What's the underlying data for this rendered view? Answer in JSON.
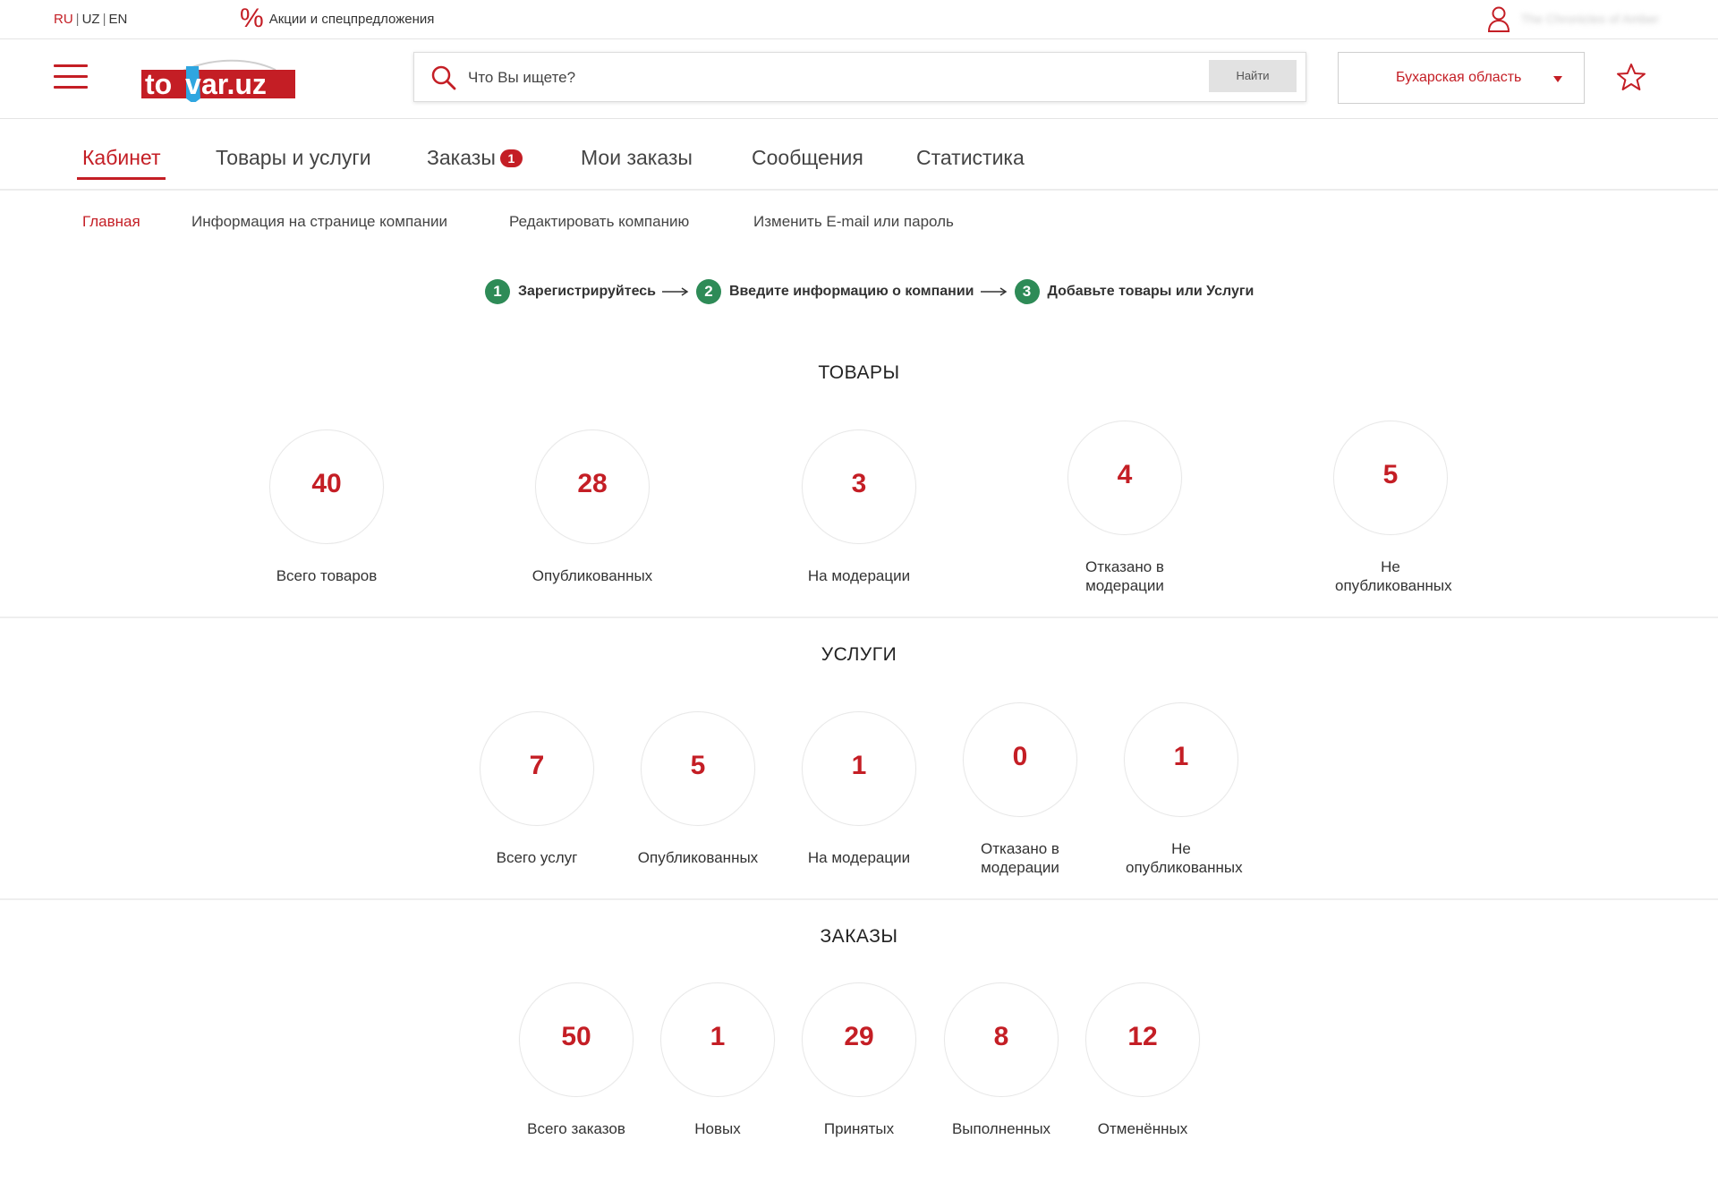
{
  "topbar": {
    "lang": {
      "ru": "RU",
      "uz": "UZ",
      "en": "EN",
      "sep": "|"
    },
    "promo_icon": "%",
    "promo_label": "Акции и спецпредложения",
    "user_name": "The Chronicles of Amber"
  },
  "header": {
    "logo": {
      "left": "to",
      "mid": "v",
      "right": "ar.uz"
    },
    "search_placeholder": "Что Вы ищете?",
    "search_button": "Найти",
    "region": "Бухарская область"
  },
  "tabs": [
    {
      "label": "Кабинет",
      "active": true
    },
    {
      "label": "Товары и услуги"
    },
    {
      "label": "Заказы",
      "badge": "1"
    },
    {
      "label": "Мои заказы"
    },
    {
      "label": "Сообщения"
    },
    {
      "label": "Статистика"
    }
  ],
  "subnav": [
    {
      "label": "Главная",
      "active": true
    },
    {
      "label": "Информация на странице компании"
    },
    {
      "label": "Редактировать компанию"
    },
    {
      "label": "Изменить E-mail или пароль"
    }
  ],
  "steps": [
    {
      "num": "1",
      "label": "Зарегистрируйтесь"
    },
    {
      "num": "2",
      "label": "Введите информацию о компании"
    },
    {
      "num": "3",
      "label": "Добавьте товары или Услуги"
    }
  ],
  "sections": {
    "goods": {
      "title": "ТОВАРЫ",
      "stats": [
        {
          "value": "40",
          "label": "Всего товаров"
        },
        {
          "value": "28",
          "label": "Опубликованных"
        },
        {
          "value": "3",
          "label": "На модерации"
        },
        {
          "value": "4",
          "label": "Отказано в модерации"
        },
        {
          "value": "5",
          "label": "Не опубликованных"
        }
      ]
    },
    "services": {
      "title": "УСЛУГИ",
      "stats": [
        {
          "value": "7",
          "label": "Всего услуг"
        },
        {
          "value": "5",
          "label": "Опубликованных"
        },
        {
          "value": "1",
          "label": "На модерации"
        },
        {
          "value": "0",
          "label": "Отказано в модерации"
        },
        {
          "value": "1",
          "label": "Не опубликованных"
        }
      ]
    },
    "orders": {
      "title": "ЗАКАЗЫ",
      "stats": [
        {
          "value": "50",
          "label": "Всего заказов"
        },
        {
          "value": "1",
          "label": "Новых"
        },
        {
          "value": "29",
          "label": "Принятых"
        },
        {
          "value": "8",
          "label": "Выполненных"
        },
        {
          "value": "12",
          "label": "Отменённых"
        }
      ]
    }
  },
  "colors": {
    "accent": "#c41e25",
    "step_green": "#2e8b57",
    "logo_blue": "#2fa6e0"
  }
}
